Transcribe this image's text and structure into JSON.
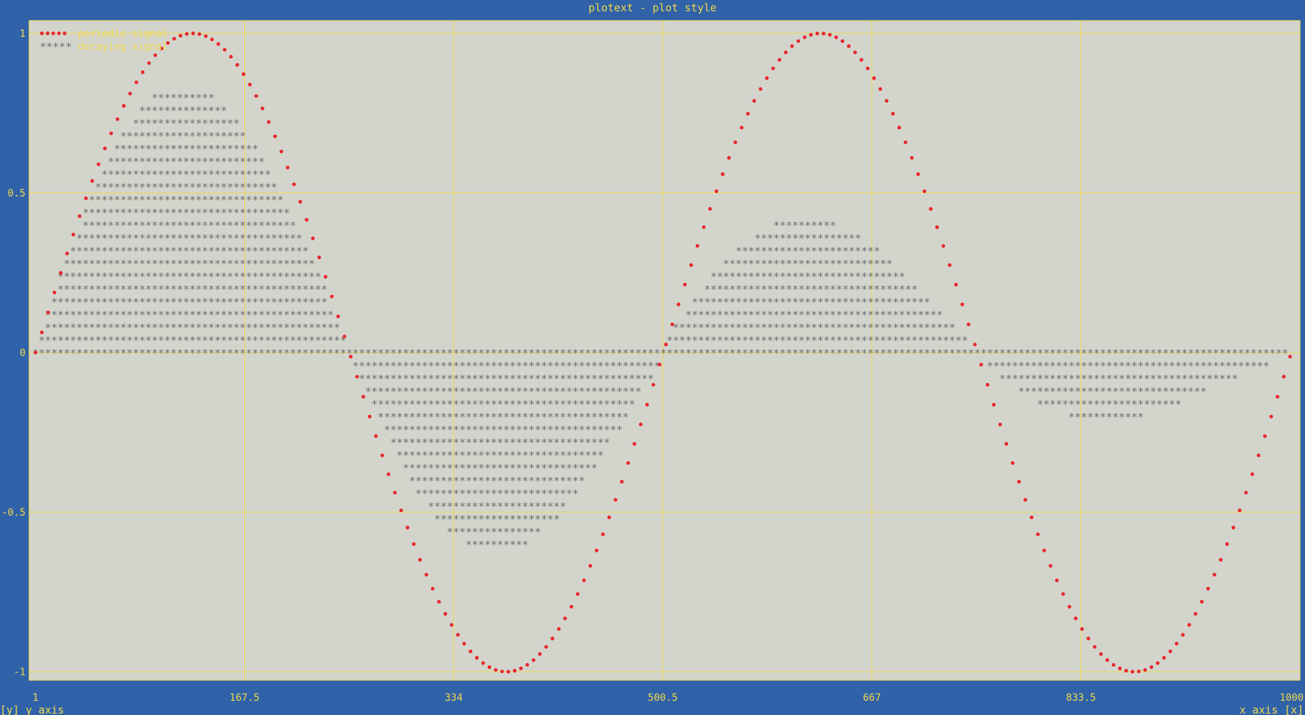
{
  "chart_data": {
    "type": "scatter",
    "title": "plotext - plot style",
    "xlabel": "x axis [x]",
    "ylabel": "[y] y axis",
    "xlim": [
      1,
      1000
    ],
    "ylim": [
      -1,
      1
    ],
    "x_ticks": [
      "1",
      "167.5",
      "334",
      "500.5",
      "667",
      "833.5",
      "1000"
    ],
    "y_ticks": [
      "1",
      "0.5",
      "0",
      "-0.5",
      "-1"
    ],
    "grid": true,
    "legend_position": "top-left",
    "series": [
      {
        "name": "periodic signal",
        "marker": "•",
        "color": "#e8282c",
        "style": "dots",
        "function": "sin",
        "period": 500,
        "amplitude": 1,
        "x_points": 200
      },
      {
        "name": "decaying signal",
        "marker": "*",
        "color": "#6e6e6e",
        "style": "filled to zero",
        "function": "sin",
        "period": 500,
        "amplitude_start": 0.92,
        "amplitude_end": 0.08,
        "decay_length": 1000,
        "sample_step": 5
      }
    ]
  },
  "colors": {
    "background": "#2f62a8",
    "plot_area": "#d3d5cd",
    "grid": "#f2d94e",
    "text": "#f2d94e",
    "periodic": "#e8282c",
    "decaying": "#6e6e6e"
  }
}
